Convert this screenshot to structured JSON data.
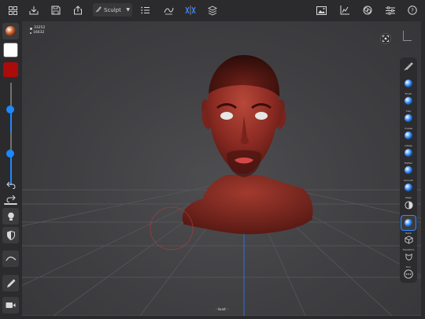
{
  "topbar": {
    "left_icons": [
      "grid-icon",
      "import-icon",
      "save-icon",
      "share-icon"
    ],
    "tool_selector": {
      "label": "Sculpt",
      "icon": "brush-icon"
    },
    "mid_icons": [
      "list-icon",
      "stroke-icon",
      "symmetry-icon",
      "layers-icon"
    ],
    "right_icons": [
      "image-icon",
      "chart-icon",
      "material-icon",
      "sliders-icon",
      "help-icon"
    ]
  },
  "viewport": {
    "stats": {
      "faces": "33252",
      "vertices": "16632"
    },
    "bottom_label": "- bust -",
    "colors": {
      "grid_line": "#5a5a5d",
      "axis_line": "#2f6fd6",
      "model_base": "#8a2a22",
      "brush_cursor": "#b23a3a"
    }
  },
  "left_toolbar": {
    "primary_color": "#ffffff",
    "secondary_color": "#aa0b0b",
    "radius_level": 0.29,
    "intensity_level": 0.2
  },
  "right_toolbar": {
    "tools": [
      {
        "name": "paint",
        "label": ""
      },
      {
        "name": "brush",
        "label": "Brush"
      },
      {
        "name": "clay",
        "label": "Clay"
      },
      {
        "name": "crease",
        "label": "Crease"
      },
      {
        "name": "inflate",
        "label": "Inflate"
      },
      {
        "name": "flatten",
        "label": "Flatten"
      },
      {
        "name": "smooth",
        "label": "Smooth"
      },
      {
        "name": "mask",
        "label": "Mask"
      },
      {
        "name": "matcap",
        "label": ""
      },
      {
        "name": "paint-active",
        "label": "Paint"
      },
      {
        "name": "transform",
        "label": "Transform"
      },
      {
        "name": "trim",
        "label": "Trim"
      },
      {
        "name": "more",
        "label": ""
      }
    ]
  }
}
